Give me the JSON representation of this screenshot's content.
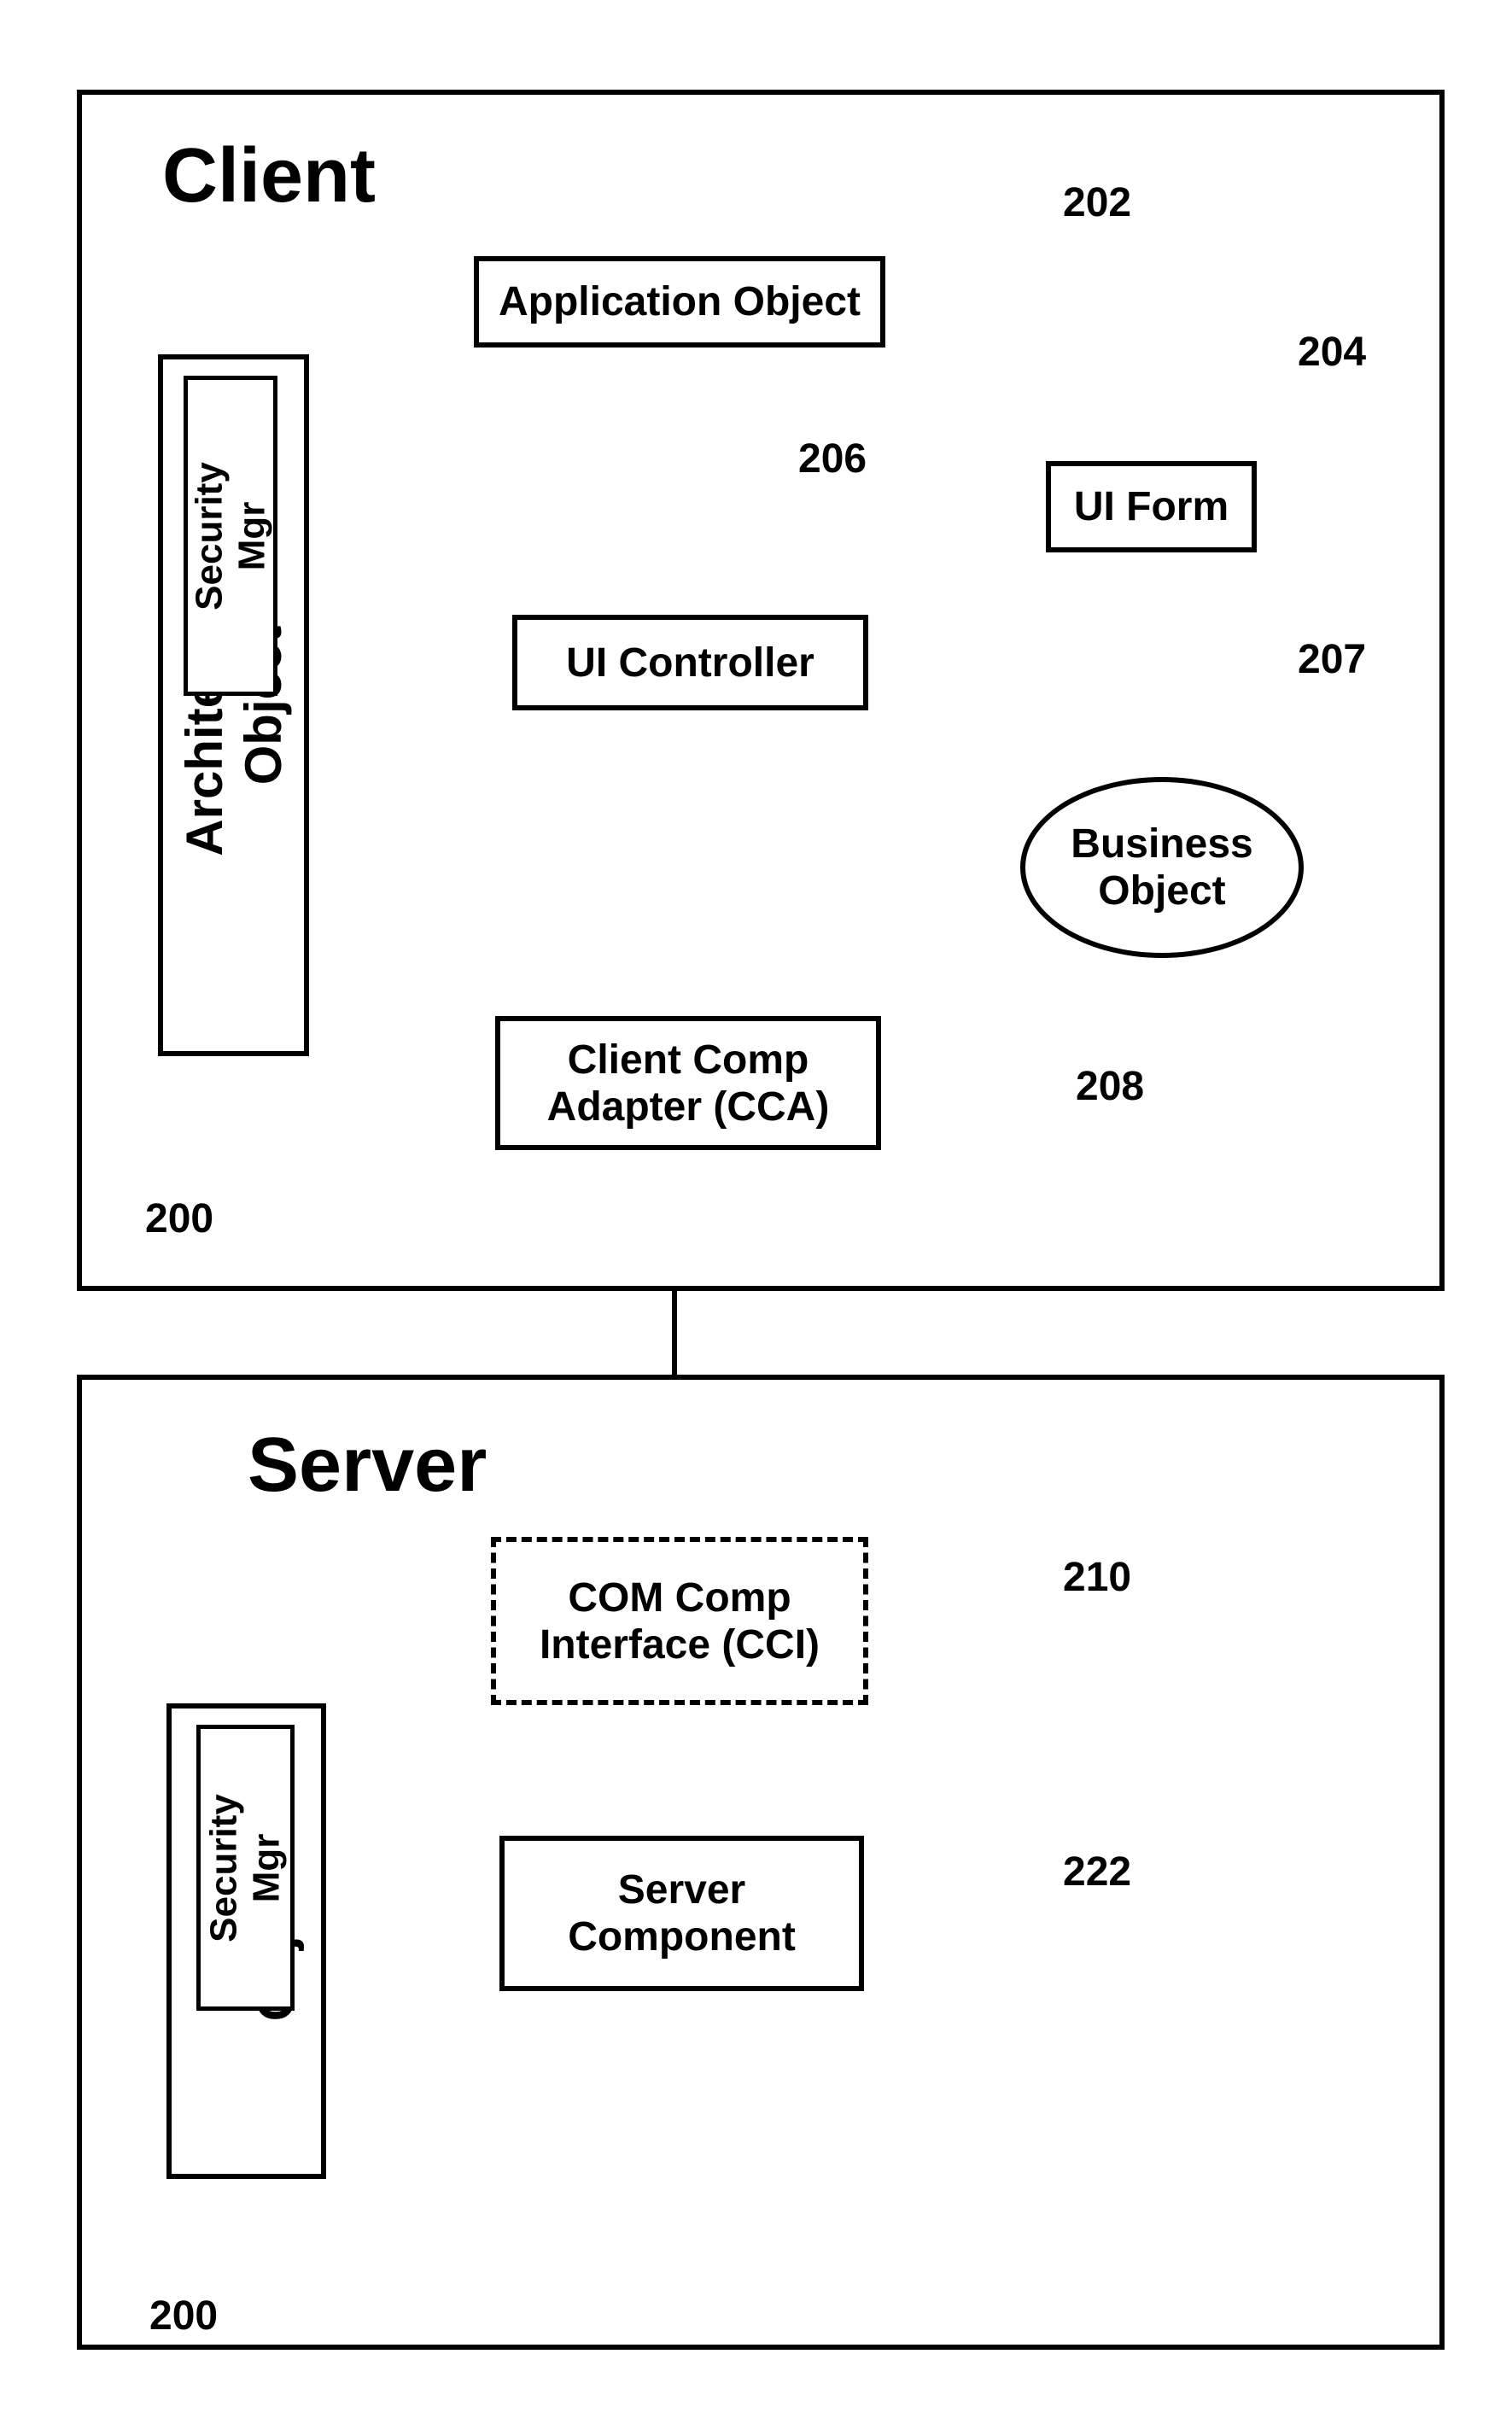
{
  "client": {
    "title": "Client",
    "arch_object": "Architecture\nObject",
    "security_mgr": "Security\nMgr",
    "application_object": "Application Object",
    "ui_controller": "UI Controller",
    "ui_form": "UI Form",
    "business_object": "Business\nObject",
    "cca": "Client Comp\nAdapter (CCA)",
    "refs": {
      "r200": "200",
      "r202": "202",
      "r204": "204",
      "r206": "206",
      "r207": "207",
      "r208": "208"
    }
  },
  "server": {
    "title": "Server",
    "arch_object": "Arch\nObject",
    "security_mgr": "Security\nMgr",
    "cci": "COM Comp\nInterface (CCI)",
    "server_component": "Server\nComponent",
    "refs": {
      "r200": "200",
      "r210": "210",
      "r222": "222"
    }
  }
}
